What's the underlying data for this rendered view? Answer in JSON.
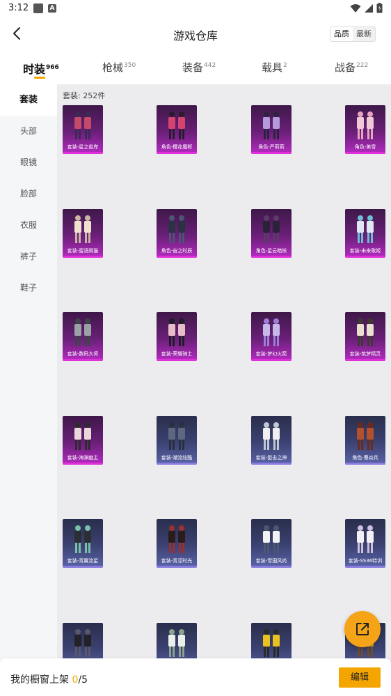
{
  "status": {
    "time": "3:12"
  },
  "header": {
    "title": "游戏仓库",
    "sort_quality": "品质",
    "sort_newest": "最新"
  },
  "tabs": [
    {
      "label": "时装",
      "count": "966"
    },
    {
      "label": "枪械",
      "count": "350"
    },
    {
      "label": "装备",
      "count": "442"
    },
    {
      "label": "载具",
      "count": "2"
    },
    {
      "label": "战备",
      "count": "222"
    }
  ],
  "sidebar": {
    "items": [
      "套装",
      "头部",
      "眼镜",
      "脸部",
      "衣服",
      "裤子",
      "鞋子"
    ]
  },
  "content": {
    "count_label": "套装: 252件"
  },
  "items": [
    {
      "name": "套装-星之俊岸",
      "rarity": "purple"
    },
    {
      "name": "角色-樱花魔断",
      "rarity": "purple"
    },
    {
      "name": "角色-严莉莉",
      "rarity": "purple"
    },
    {
      "name": "角色-美雪",
      "rarity": "purple"
    },
    {
      "name": "套装-蜜语嫣猫",
      "rarity": "purple"
    },
    {
      "name": "角色-宙之时辰",
      "rarity": "purple"
    },
    {
      "name": "角色-星云暗核",
      "rarity": "purple"
    },
    {
      "name": "套装-未来歌姬",
      "rarity": "purple"
    },
    {
      "name": "套装-数码大师",
      "rarity": "purple"
    },
    {
      "name": "套装-荣耀骑士",
      "rarity": "purple"
    },
    {
      "name": "套装-梦幻火箭",
      "rarity": "purple"
    },
    {
      "name": "套装-筑梦精灵",
      "rarity": "purple"
    },
    {
      "name": "套装-海渊幽主",
      "rarity": "purple"
    },
    {
      "name": "套装-潮流炫酷",
      "rarity": "blue"
    },
    {
      "name": "套装-狙击之神",
      "rarity": "blue"
    },
    {
      "name": "角色-曹焱兵",
      "rarity": "blue"
    },
    {
      "name": "套装-青翼流星",
      "rarity": "blue"
    },
    {
      "name": "套装-青涩时光",
      "rarity": "blue"
    },
    {
      "name": "套装-雪国风尚",
      "rarity": "blue"
    },
    {
      "name": "套装-SS36特训",
      "rarity": "blue"
    },
    {
      "name": "",
      "rarity": "blue"
    },
    {
      "name": "",
      "rarity": "blue"
    },
    {
      "name": "",
      "rarity": "blue"
    },
    {
      "name": "",
      "rarity": "blue"
    }
  ],
  "bottom": {
    "showcase_label": "我的橱窗上架",
    "current": "0",
    "max": "5",
    "edit_label": "编辑"
  },
  "colors": {
    "accent": "#f5a500",
    "purple_rarity": "#b42bc1",
    "blue_rarity": "#5a64a8"
  }
}
